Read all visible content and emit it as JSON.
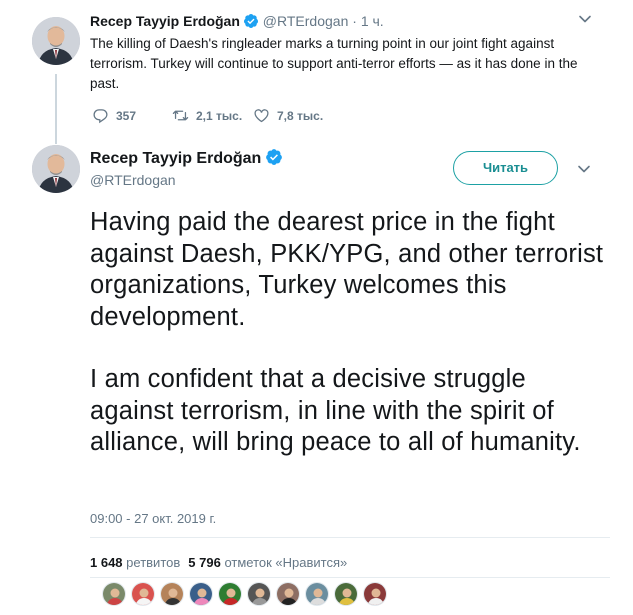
{
  "parent_tweet": {
    "name": "Recep Tayyip Erdoğan",
    "handle": "@RTErdogan",
    "separator": "·",
    "time": "1 ч.",
    "text": "The killing of Daesh's ringleader marks a turning point in our joint fight against terrorism. Turkey will continue to support anti-terror efforts — as it has done in the past.",
    "reply_count": "357",
    "retweet_count": "2,1 тыс.",
    "like_count": "7,8 тыс."
  },
  "main_tweet": {
    "name": "Recep Tayyip Erdoğan",
    "handle": "@RTErdogan",
    "follow_label": "Читать",
    "paragraphs": [
      "Having paid the dearest price in the fight against Daesh, PKK/YPG, and other terrorist organizations, Turkey welcomes this development.",
      "I am confident that a decisive struggle against terrorism, in line with the spirit of alliance, will bring peace to all of humanity."
    ],
    "timestamp": "09:00 - 27 окт. 2019 г.",
    "retweets_value": "1 648",
    "retweets_label": "ретвитов",
    "likes_value": "5 796",
    "likes_label": "отметок «Нравится»"
  },
  "liker_avatars": [
    {
      "color": "#7a8a6a",
      "accent": "#c44"
    },
    {
      "color": "#d9534f",
      "accent": "#f5f5f5"
    },
    {
      "color": "#b5835a",
      "accent": "#333"
    },
    {
      "color": "#3a5f8a",
      "accent": "#e8b"
    },
    {
      "color": "#2e7d32",
      "accent": "#c62828"
    },
    {
      "color": "#555555",
      "accent": "#999"
    },
    {
      "color": "#8d6e63",
      "accent": "#222"
    },
    {
      "color": "#6b8e9f",
      "accent": "#ddd"
    },
    {
      "color": "#4a6b3a",
      "accent": "#e0c040"
    },
    {
      "color": "#8a3a3a",
      "accent": "#f0f0f0"
    }
  ],
  "colors": {
    "accent": "#1da1f2",
    "follow_accent": "#1a8e92",
    "muted": "#657786",
    "verified": "#1da1f2"
  },
  "icons": [
    "reply-icon",
    "retweet-icon",
    "like-icon",
    "verified-badge-icon",
    "chevron-down-icon"
  ]
}
